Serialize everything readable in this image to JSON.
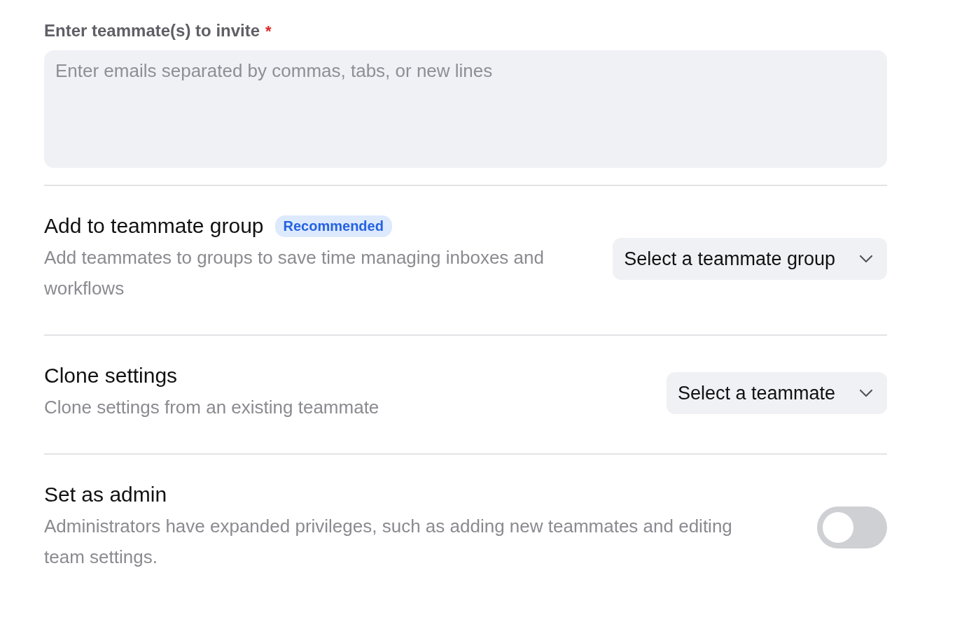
{
  "invite": {
    "label": "Enter teammate(s) to invite",
    "required_mark": "*",
    "placeholder": "Enter emails separated by commas, tabs, or new lines"
  },
  "sections": [
    {
      "kind": "select",
      "title": "Add to teammate group",
      "badge": "Recommended",
      "description": "Add teammates to groups to save time managing inboxes and workflows",
      "control": "Select a teammate group"
    },
    {
      "kind": "select",
      "title": "Clone settings",
      "description": "Clone settings from an existing teammate",
      "control": "Select a teammate"
    },
    {
      "kind": "toggle",
      "title": "Set as admin",
      "description": "Administrators have expanded privileges, such as adding new teammates and editing team settings.",
      "on": false
    }
  ]
}
